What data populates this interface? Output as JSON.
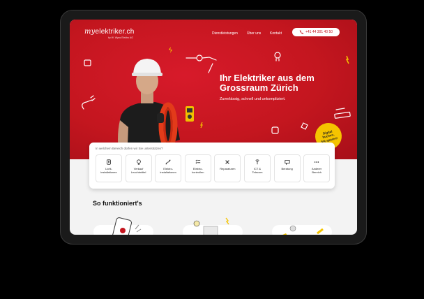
{
  "brand": {
    "logo_my": "my",
    "logo_main": "elektriker.ch",
    "logo_sub": "by W. Wyss Elektro AG"
  },
  "nav": {
    "items": [
      {
        "label": "Dienstleistungen"
      },
      {
        "label": "Über uns"
      },
      {
        "label": "Kontakt"
      }
    ],
    "phone": "+41 44 301 40 50"
  },
  "hero": {
    "headline_line1": "Ihr Elektriker aus dem",
    "headline_line2": "Grossraum Zürich",
    "subline": "Zuverlässig, schnell und unkompliziert."
  },
  "badge": {
    "line1": "Digital",
    "line2": "buchen,",
    "line3": "5% sparen!"
  },
  "services": {
    "question": "In welchem Bereich dürfen wir Sie unterstützen?",
    "items": [
      {
        "line1": "Licht-",
        "line2": "installationen",
        "icon": "light-switch-icon"
      },
      {
        "line1": "Verkauf",
        "line2": "Leuchtmittel",
        "icon": "bulb-icon"
      },
      {
        "line1": "Elektro-",
        "line2": "installationen",
        "icon": "cable-icon"
      },
      {
        "line1": "Elektro-",
        "line2": "kontrollen",
        "icon": "checklist-icon"
      },
      {
        "line1": "Reparaturen",
        "line2": "",
        "icon": "tools-icon"
      },
      {
        "line1": "ICT &",
        "line2": "Telecom",
        "icon": "antenna-icon"
      },
      {
        "line1": "Beratung",
        "line2": "",
        "icon": "chat-icon"
      },
      {
        "line1": "Anderer",
        "line2": "Bereich",
        "icon": "more-icon"
      }
    ]
  },
  "how_it_works": {
    "title": "So funktioniert's"
  },
  "colors": {
    "brand_red": "#c4161f",
    "badge_yellow": "#f5c400"
  }
}
